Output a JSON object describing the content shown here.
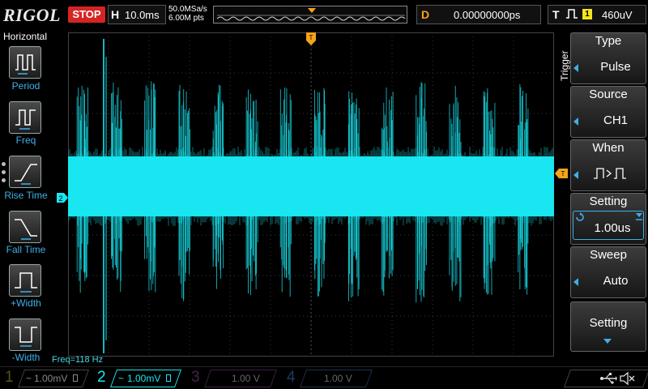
{
  "brand": "RIGOL",
  "run_state": "STOP",
  "timebase": {
    "label": "H",
    "value": "10.0ms"
  },
  "sample_rate": "50.0MSa/s",
  "memory_points": "6.00M pts",
  "delay": {
    "label": "D",
    "value": "0.00000000ps"
  },
  "trigger_status": {
    "label": "T",
    "channel": "1",
    "level": "460uV"
  },
  "horizontal_menu": {
    "title": "Horizontal",
    "items": [
      {
        "label": "Period",
        "icon": "period-icon"
      },
      {
        "label": "Freq",
        "icon": "frequency-icon"
      },
      {
        "label": "Rise Time",
        "icon": "rise-time-icon"
      },
      {
        "label": "Fall Time",
        "icon": "fall-time-icon"
      },
      {
        "label": "+Width",
        "icon": "positive-width-icon"
      },
      {
        "label": "-Width",
        "icon": "negative-width-icon"
      }
    ]
  },
  "trigger_menu": {
    "title": "Trigger",
    "type": {
      "title": "Type",
      "value": "Pulse"
    },
    "source": {
      "title": "Source",
      "value": "CH1"
    },
    "when": {
      "title": "When",
      "value": "⌐F>⌐L"
    },
    "setting": {
      "title": "Setting",
      "value": "1.00us"
    },
    "sweep": {
      "title": "Sweep",
      "value": "Auto"
    },
    "more": {
      "title": "Setting"
    }
  },
  "measurement": "Freq=118 Hz",
  "channel_marker": "2",
  "trigger_marker": "T",
  "channels": [
    {
      "num": "1",
      "coupling": "~",
      "scale": "1.00mV",
      "color": "#f2e51a"
    },
    {
      "num": "2",
      "coupling": "~",
      "scale": "1.00mV",
      "color": "#19e6f0"
    },
    {
      "num": "3",
      "coupling": "",
      "scale": "1.00 V",
      "color": "#c040c0"
    },
    {
      "num": "4",
      "coupling": "",
      "scale": "1.00 V",
      "color": "#2a7ad8"
    }
  ],
  "colors": {
    "trace": "#19e6f0",
    "trigger": "#f7a21b",
    "ch1": "#f2e51a",
    "accent": "#3fb0e8"
  },
  "status_icons": [
    "usb-icon",
    "speaker-mute-icon"
  ]
}
